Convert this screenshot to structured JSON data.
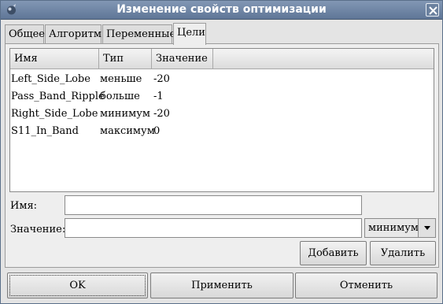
{
  "window": {
    "title": "Изменение свойств оптимизации"
  },
  "tabs": [
    {
      "label": "Общее",
      "active": false
    },
    {
      "label": "Алгоритм",
      "active": false
    },
    {
      "label": "Переменные",
      "active": false
    },
    {
      "label": "Цели",
      "active": true
    }
  ],
  "goals_table": {
    "columns": [
      "Имя",
      "Тип",
      "Значение"
    ],
    "rows": [
      {
        "name": "Left_Side_Lobe",
        "type": "меньше",
        "value": "-20"
      },
      {
        "name": "Pass_Band_Ripple",
        "type": "больше",
        "value": "-1"
      },
      {
        "name": "Right_Side_Lobe",
        "type": "минимум",
        "value": "-20"
      },
      {
        "name": "S11_In_Band",
        "type": "максимум",
        "value": "0"
      }
    ]
  },
  "form": {
    "name_label": "Имя:",
    "name_value": "",
    "value_label": "Значение:",
    "value_value": "",
    "type_selected": "минимум"
  },
  "buttons": {
    "add": "Добавить",
    "delete": "Удалить",
    "ok": "OK",
    "apply": "Применить",
    "cancel": "Отменить"
  }
}
